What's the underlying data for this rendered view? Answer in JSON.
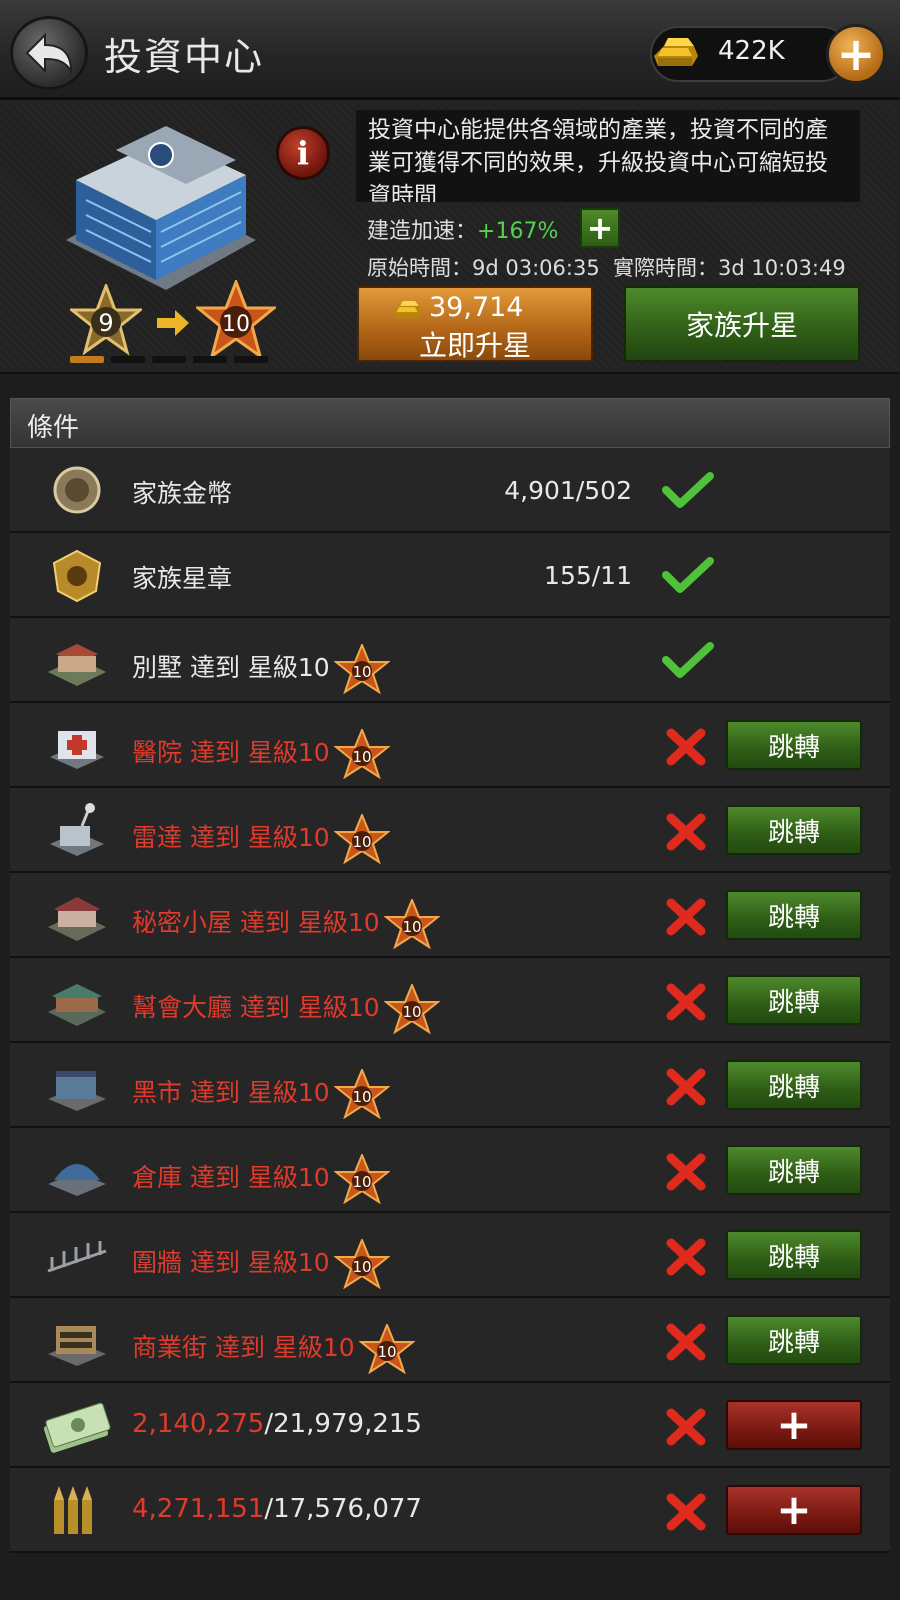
{
  "header": {
    "title": "投資中心",
    "gold": "422K"
  },
  "building": {
    "description": "投資中心能提供各領域的產業，投資不同的產業可獲得不同的效果，升級投資中心可縮短投資時間",
    "current_star": "9",
    "next_star": "10",
    "speed_label": "建造加速：",
    "speed_value": "+167%",
    "original_time_label": "原始時間：",
    "original_time": "9d 03:06:35",
    "actual_time_label": "實際時間：",
    "actual_time": "3d 10:03:49",
    "upgrade_cost": "39,714",
    "upgrade_now_label": "立即升星",
    "family_upgrade_label": "家族升星",
    "progress": {
      "filled": 1,
      "total": 5
    }
  },
  "conditions": {
    "header": "條件",
    "rows": [
      {
        "icon": "family-coin-icon",
        "name": "家族金幣",
        "count": "4,901/502",
        "met": true
      },
      {
        "icon": "family-medal-icon",
        "name": "家族星章",
        "count": "155/11",
        "met": true
      },
      {
        "icon": "villa-icon",
        "name": "別墅 達到 星級10",
        "star": "10",
        "met": true
      },
      {
        "icon": "hospital-icon",
        "name": "醫院 達到 星級10",
        "star": "10",
        "met": false,
        "action": "跳轉"
      },
      {
        "icon": "radar-icon",
        "name": "雷達 達到 星級10",
        "star": "10",
        "met": false,
        "action": "跳轉"
      },
      {
        "icon": "secret-house-icon",
        "name": "秘密小屋 達到 星級10",
        "star": "10",
        "met": false,
        "action": "跳轉"
      },
      {
        "icon": "gang-hall-icon",
        "name": "幫會大廳 達到 星級10",
        "star": "10",
        "met": false,
        "action": "跳轉"
      },
      {
        "icon": "black-market-icon",
        "name": "黑市 達到 星級10",
        "star": "10",
        "met": false,
        "action": "跳轉"
      },
      {
        "icon": "warehouse-icon",
        "name": "倉庫 達到 星級10",
        "star": "10",
        "met": false,
        "action": "跳轉"
      },
      {
        "icon": "fence-icon",
        "name": "圍牆 達到 星級10",
        "star": "10",
        "met": false,
        "action": "跳轉"
      },
      {
        "icon": "business-street-icon",
        "name": "商業街 達到 星級10",
        "star": "10",
        "met": false,
        "action": "跳轉"
      },
      {
        "icon": "cash-icon",
        "current": "2,140,275",
        "required": "/21,979,215",
        "met": false,
        "action": "+"
      },
      {
        "icon": "ammo-icon",
        "current": "4,271,151",
        "required": "/17,576,077",
        "met": false,
        "action": "+"
      }
    ]
  },
  "colors": {
    "accent_orange": "#c47a1e",
    "accent_green": "#3f7a22",
    "unmet_red": "#e03a2a",
    "speed_green": "#55d24a"
  }
}
